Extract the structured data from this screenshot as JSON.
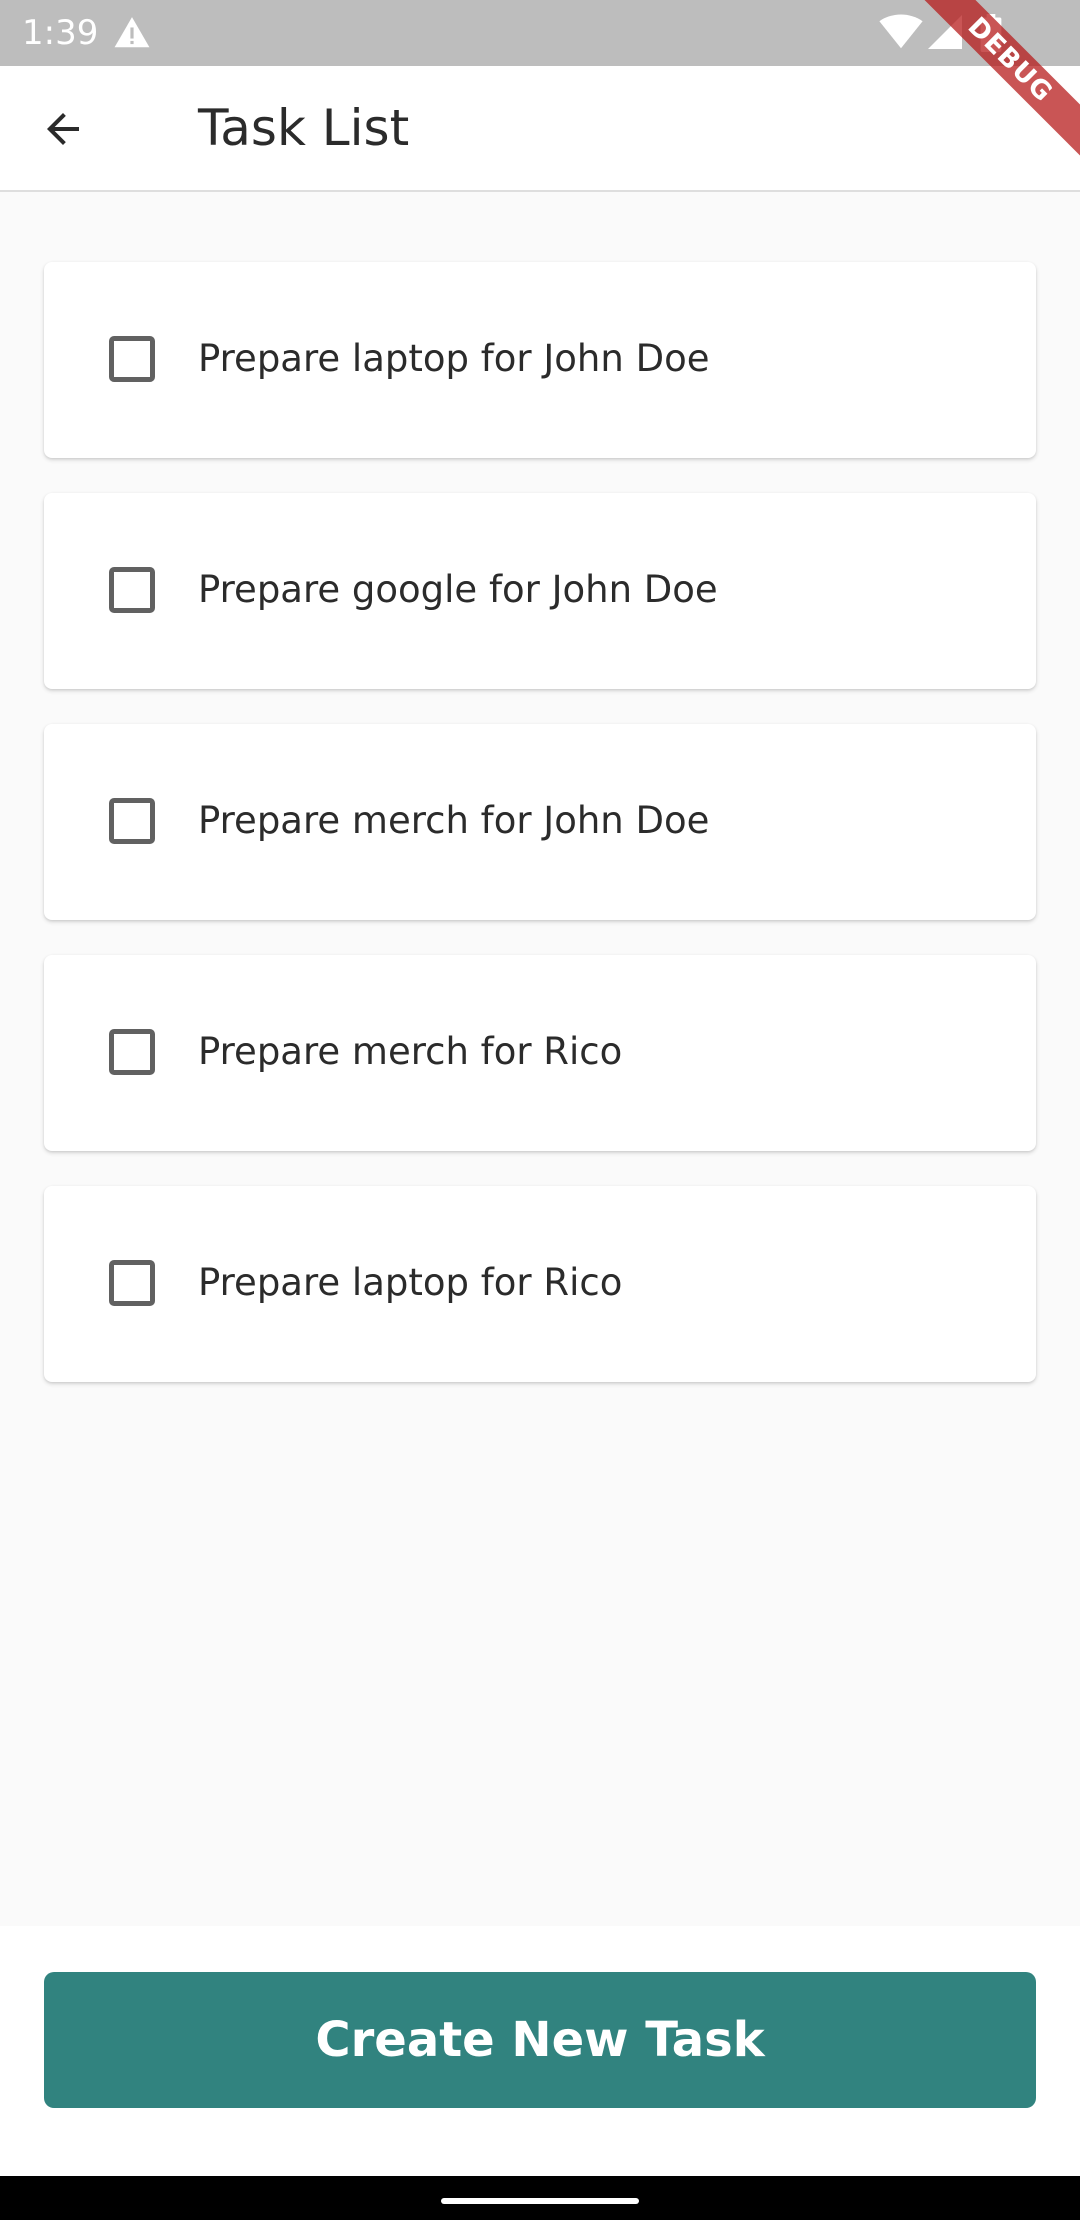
{
  "status_bar": {
    "time": "1:39",
    "icons": [
      "warning-icon",
      "wifi-icon",
      "signal-icon",
      "battery-icon"
    ]
  },
  "debug_banner": {
    "label": "DEBUG"
  },
  "app_bar": {
    "back_icon": "arrow-back-icon",
    "title": "Task List"
  },
  "tasks": [
    {
      "label": "Prepare laptop for John Doe",
      "checked": false
    },
    {
      "label": "Prepare google for John Doe",
      "checked": false
    },
    {
      "label": "Prepare merch for John Doe",
      "checked": false
    },
    {
      "label": "Prepare merch for Rico",
      "checked": false
    },
    {
      "label": "Prepare laptop for Rico",
      "checked": false
    }
  ],
  "footer": {
    "create_button_label": "Create New Task"
  },
  "colors": {
    "primary": "#31837f",
    "status_bar": "#bdbdbd",
    "background": "#fafafa",
    "debug_banner": "#b71c1c"
  }
}
